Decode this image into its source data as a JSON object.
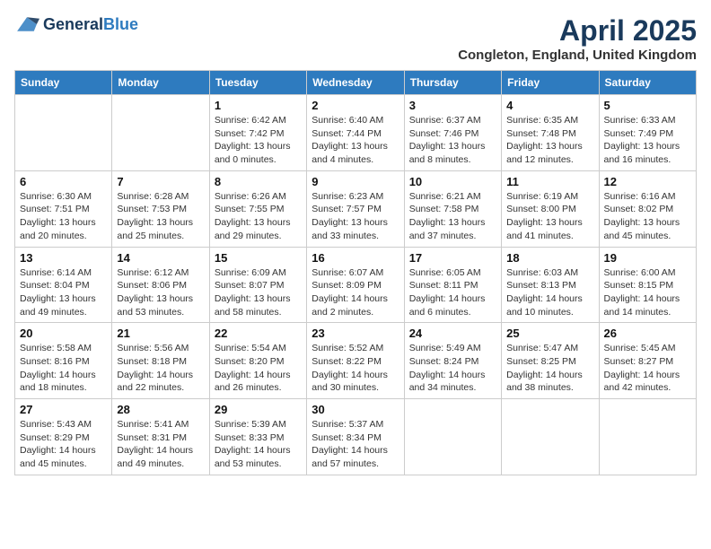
{
  "header": {
    "logo_general": "General",
    "logo_blue": "Blue",
    "month_title": "April 2025",
    "location": "Congleton, England, United Kingdom"
  },
  "days_of_week": [
    "Sunday",
    "Monday",
    "Tuesday",
    "Wednesday",
    "Thursday",
    "Friday",
    "Saturday"
  ],
  "weeks": [
    [
      {
        "day": "",
        "info": ""
      },
      {
        "day": "",
        "info": ""
      },
      {
        "day": "1",
        "info": "Sunrise: 6:42 AM\nSunset: 7:42 PM\nDaylight: 13 hours and 0 minutes."
      },
      {
        "day": "2",
        "info": "Sunrise: 6:40 AM\nSunset: 7:44 PM\nDaylight: 13 hours and 4 minutes."
      },
      {
        "day": "3",
        "info": "Sunrise: 6:37 AM\nSunset: 7:46 PM\nDaylight: 13 hours and 8 minutes."
      },
      {
        "day": "4",
        "info": "Sunrise: 6:35 AM\nSunset: 7:48 PM\nDaylight: 13 hours and 12 minutes."
      },
      {
        "day": "5",
        "info": "Sunrise: 6:33 AM\nSunset: 7:49 PM\nDaylight: 13 hours and 16 minutes."
      }
    ],
    [
      {
        "day": "6",
        "info": "Sunrise: 6:30 AM\nSunset: 7:51 PM\nDaylight: 13 hours and 20 minutes."
      },
      {
        "day": "7",
        "info": "Sunrise: 6:28 AM\nSunset: 7:53 PM\nDaylight: 13 hours and 25 minutes."
      },
      {
        "day": "8",
        "info": "Sunrise: 6:26 AM\nSunset: 7:55 PM\nDaylight: 13 hours and 29 minutes."
      },
      {
        "day": "9",
        "info": "Sunrise: 6:23 AM\nSunset: 7:57 PM\nDaylight: 13 hours and 33 minutes."
      },
      {
        "day": "10",
        "info": "Sunrise: 6:21 AM\nSunset: 7:58 PM\nDaylight: 13 hours and 37 minutes."
      },
      {
        "day": "11",
        "info": "Sunrise: 6:19 AM\nSunset: 8:00 PM\nDaylight: 13 hours and 41 minutes."
      },
      {
        "day": "12",
        "info": "Sunrise: 6:16 AM\nSunset: 8:02 PM\nDaylight: 13 hours and 45 minutes."
      }
    ],
    [
      {
        "day": "13",
        "info": "Sunrise: 6:14 AM\nSunset: 8:04 PM\nDaylight: 13 hours and 49 minutes."
      },
      {
        "day": "14",
        "info": "Sunrise: 6:12 AM\nSunset: 8:06 PM\nDaylight: 13 hours and 53 minutes."
      },
      {
        "day": "15",
        "info": "Sunrise: 6:09 AM\nSunset: 8:07 PM\nDaylight: 13 hours and 58 minutes."
      },
      {
        "day": "16",
        "info": "Sunrise: 6:07 AM\nSunset: 8:09 PM\nDaylight: 14 hours and 2 minutes."
      },
      {
        "day": "17",
        "info": "Sunrise: 6:05 AM\nSunset: 8:11 PM\nDaylight: 14 hours and 6 minutes."
      },
      {
        "day": "18",
        "info": "Sunrise: 6:03 AM\nSunset: 8:13 PM\nDaylight: 14 hours and 10 minutes."
      },
      {
        "day": "19",
        "info": "Sunrise: 6:00 AM\nSunset: 8:15 PM\nDaylight: 14 hours and 14 minutes."
      }
    ],
    [
      {
        "day": "20",
        "info": "Sunrise: 5:58 AM\nSunset: 8:16 PM\nDaylight: 14 hours and 18 minutes."
      },
      {
        "day": "21",
        "info": "Sunrise: 5:56 AM\nSunset: 8:18 PM\nDaylight: 14 hours and 22 minutes."
      },
      {
        "day": "22",
        "info": "Sunrise: 5:54 AM\nSunset: 8:20 PM\nDaylight: 14 hours and 26 minutes."
      },
      {
        "day": "23",
        "info": "Sunrise: 5:52 AM\nSunset: 8:22 PM\nDaylight: 14 hours and 30 minutes."
      },
      {
        "day": "24",
        "info": "Sunrise: 5:49 AM\nSunset: 8:24 PM\nDaylight: 14 hours and 34 minutes."
      },
      {
        "day": "25",
        "info": "Sunrise: 5:47 AM\nSunset: 8:25 PM\nDaylight: 14 hours and 38 minutes."
      },
      {
        "day": "26",
        "info": "Sunrise: 5:45 AM\nSunset: 8:27 PM\nDaylight: 14 hours and 42 minutes."
      }
    ],
    [
      {
        "day": "27",
        "info": "Sunrise: 5:43 AM\nSunset: 8:29 PM\nDaylight: 14 hours and 45 minutes."
      },
      {
        "day": "28",
        "info": "Sunrise: 5:41 AM\nSunset: 8:31 PM\nDaylight: 14 hours and 49 minutes."
      },
      {
        "day": "29",
        "info": "Sunrise: 5:39 AM\nSunset: 8:33 PM\nDaylight: 14 hours and 53 minutes."
      },
      {
        "day": "30",
        "info": "Sunrise: 5:37 AM\nSunset: 8:34 PM\nDaylight: 14 hours and 57 minutes."
      },
      {
        "day": "",
        "info": ""
      },
      {
        "day": "",
        "info": ""
      },
      {
        "day": "",
        "info": ""
      }
    ]
  ]
}
